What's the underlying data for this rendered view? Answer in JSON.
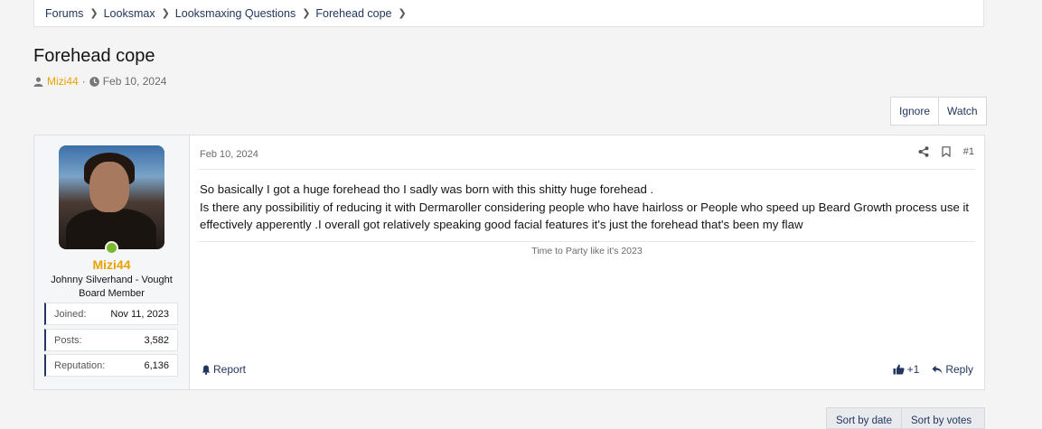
{
  "breadcrumb": [
    "Forums",
    "Looksmax",
    "Looksmaxing Questions",
    "Forehead cope"
  ],
  "thread": {
    "title": "Forehead cope",
    "author": "Mizi44",
    "date": "Feb 10, 2024"
  },
  "actions": {
    "ignore": "Ignore",
    "watch": "Watch"
  },
  "post": {
    "date": "Feb 10, 2024",
    "number": "#1",
    "body": [
      "So basically I got a huge forehead tho I sadly was born with this shitty huge forehead .",
      "Is there any possibilitiy of reducing it with Dermaroller considering people who have hairloss or People who speed up Beard Growth process use it effectively apperently .I overall got relatively speaking good facial features it's just the forehead that's been my flaw"
    ],
    "signature": "Time to Party like it's 2023",
    "report": "Report",
    "reaction_count": "+1",
    "reply": "Reply"
  },
  "user": {
    "name": "Mizi44",
    "title_line1": "Johnny Silverhand - Vought",
    "title_line2": "Board Member",
    "online": true,
    "stats": [
      {
        "label": "Joined:",
        "value": "Nov 11, 2023"
      },
      {
        "label": "Posts:",
        "value": "3,582"
      },
      {
        "label": "Reputation:",
        "value": "6,136"
      }
    ]
  },
  "sort": {
    "by_date": "Sort by date",
    "by_votes": "Sort by votes"
  },
  "colors": {
    "accent": "#22365e",
    "username": "#e8a300",
    "online": "#7db730"
  }
}
